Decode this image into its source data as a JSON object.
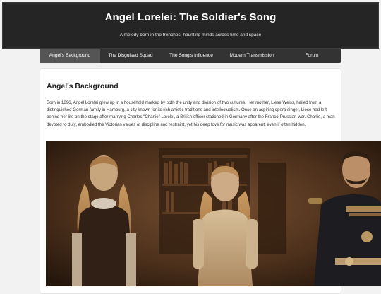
{
  "header": {
    "title": "Angel Lorelei: The Soldier's Song",
    "subtitle": "A melody born in the trenches, haunting minds across time and space"
  },
  "nav": {
    "tabs": [
      {
        "label": "Angel's Background"
      },
      {
        "label": "The Disguised Squad"
      },
      {
        "label": "The Song's Influence"
      },
      {
        "label": "Modern Transmission"
      },
      {
        "label": "Forum"
      }
    ]
  },
  "section": {
    "heading": "Angel's Background",
    "paragraph": "Born in 1896, Angel Lorelei grew up in a household marked by both the unity and division of two cultures. Her mother, Liese Weiss, hailed from a distinguished German family in Hamburg, a city known for its rich artistic traditions and intellectualism. Once an aspiring opera singer, Liese had left behind her life on the stage after marrying Charles \"Charlie\" Lorelei, a British officer stationed in Germany after the Franco-Prussian war. Charlie, a man devoted to duty, embodied the Victorian values of discipline and restraint, yet his deep love for music was apparent, even if often hidden."
  },
  "photo": {
    "subject": "sepia family portrait: two girls and a uniformed officer in a library"
  }
}
